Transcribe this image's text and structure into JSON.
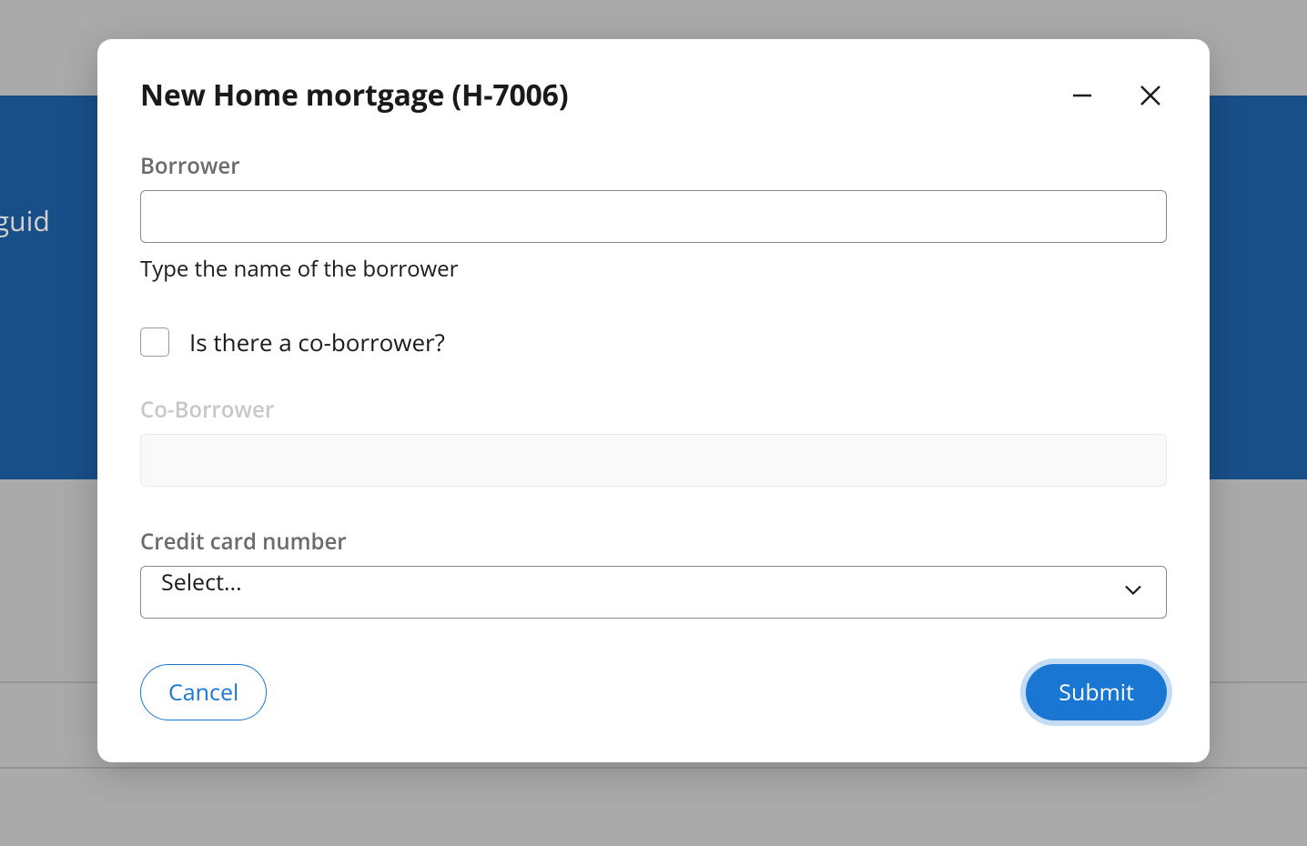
{
  "backdrop": {
    "partial_text": "ne guid"
  },
  "modal": {
    "title": "New Home mortgage (H-7006)",
    "form": {
      "borrower": {
        "label": "Borrower",
        "value": "",
        "help": "Type the name of the borrower"
      },
      "co_borrower_checkbox": {
        "label": "Is there a co-borrower?",
        "checked": false
      },
      "co_borrower": {
        "label": "Co-Borrower",
        "value": "",
        "disabled": true
      },
      "credit_card": {
        "label": "Credit card number",
        "selected": "Select..."
      }
    },
    "footer": {
      "cancel": "Cancel",
      "submit": "Submit"
    }
  }
}
